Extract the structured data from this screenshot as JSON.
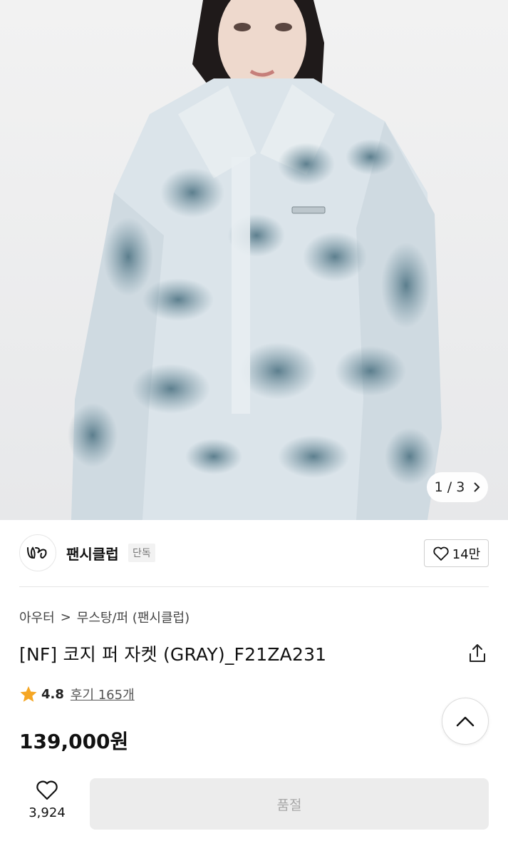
{
  "gallery": {
    "current": "1",
    "total": "3",
    "separator": "/",
    "next_icon": "chevron-right-icon"
  },
  "brand": {
    "name": "팬시클럽",
    "badge": "단독",
    "logo_icon": "fancy-club-logo"
  },
  "likes": {
    "count": "14만",
    "icon": "heart-outline-icon"
  },
  "breadcrumb": {
    "category": "아우터",
    "separator": ">",
    "subcategory": "무스탕/퍼 (팬시클럽)"
  },
  "product": {
    "title": "[NF] 코지 퍼 자켓 (GRAY)_F21ZA231",
    "rating": "4.8",
    "reviews": "후기 165개",
    "price": "139,000원"
  },
  "actions": {
    "share_icon": "share-icon",
    "scroll_top_icon": "chevron-up-icon",
    "wish_count": "3,924",
    "purchase_label": "품절"
  },
  "colors": {
    "star": "#f5a623",
    "soldout_bg": "#ececec",
    "soldout_text": "#a8a8a8"
  }
}
